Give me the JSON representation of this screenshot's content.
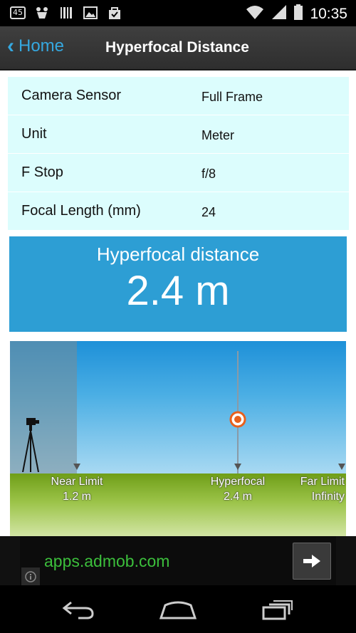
{
  "status_bar": {
    "notification_badge": "45",
    "time": "10:35",
    "icons": [
      "notification-45-icon",
      "gift-icon",
      "barcode-icon",
      "image-icon",
      "shopping-bag-icon",
      "wifi-icon",
      "signal-icon",
      "battery-icon"
    ]
  },
  "action_bar": {
    "back_label": "Home",
    "title": "Hyperfocal Distance"
  },
  "settings": [
    {
      "label": "Camera Sensor",
      "value": "Full Frame"
    },
    {
      "label": "Unit",
      "value": "Meter"
    },
    {
      "label": "F Stop",
      "value": "f/8"
    },
    {
      "label": "Focal Length (mm)",
      "value": "24"
    }
  ],
  "result": {
    "title": "Hyperfocal distance",
    "value": "2.4 m"
  },
  "diagram": {
    "near": {
      "label": "Near Limit",
      "value": "1.2 m"
    },
    "hyperfocal": {
      "label": "Hyperfocal",
      "value": "2.4 m"
    },
    "far": {
      "label": "Far Limit",
      "value": "Infinity"
    }
  },
  "ad": {
    "text": "apps.admob.com",
    "info_icon": "info-icon",
    "arrow_icon": "arrow-right-icon"
  },
  "nav": [
    "back-nav-icon",
    "home-nav-icon",
    "recents-nav-icon"
  ],
  "colors": {
    "accent": "#35a8e0",
    "result_bg": "#2d9ed4",
    "settings_bg": "#dcfdfd",
    "ad_text": "#3cbf3c",
    "marker": "#e8601c"
  }
}
